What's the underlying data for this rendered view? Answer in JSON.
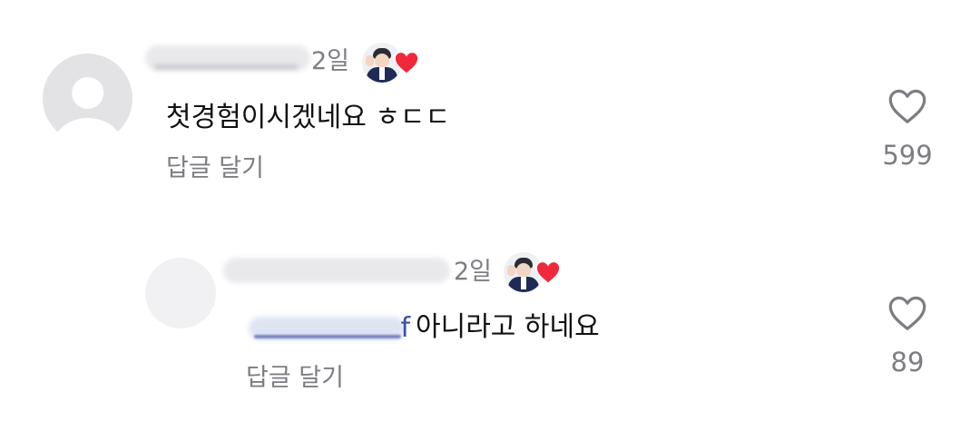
{
  "comments": [
    {
      "time": "2일",
      "text": "첫경험이시겠네요 ㅎㄷㄷ",
      "reply_label": "답글 달기",
      "like_count": "599",
      "creator_liked": true,
      "avatar_icon": "default-profile-icon"
    }
  ],
  "replies": [
    {
      "time": "2일",
      "mention_tail": "f",
      "text": "아니라고 하네요",
      "reply_label": "답글 달기",
      "like_count": "89",
      "creator_liked": true,
      "avatar_icon": "blank-profile-icon"
    }
  ],
  "colors": {
    "text_primary": "#111111",
    "text_secondary": "#7d7d83",
    "mention": "#3950a8",
    "liked_heart": "#f0283c",
    "avatar_placeholder": "#e3e3e6"
  },
  "icons": {
    "like": "heart-outline-icon",
    "creator_like": "heart-filled-icon"
  }
}
